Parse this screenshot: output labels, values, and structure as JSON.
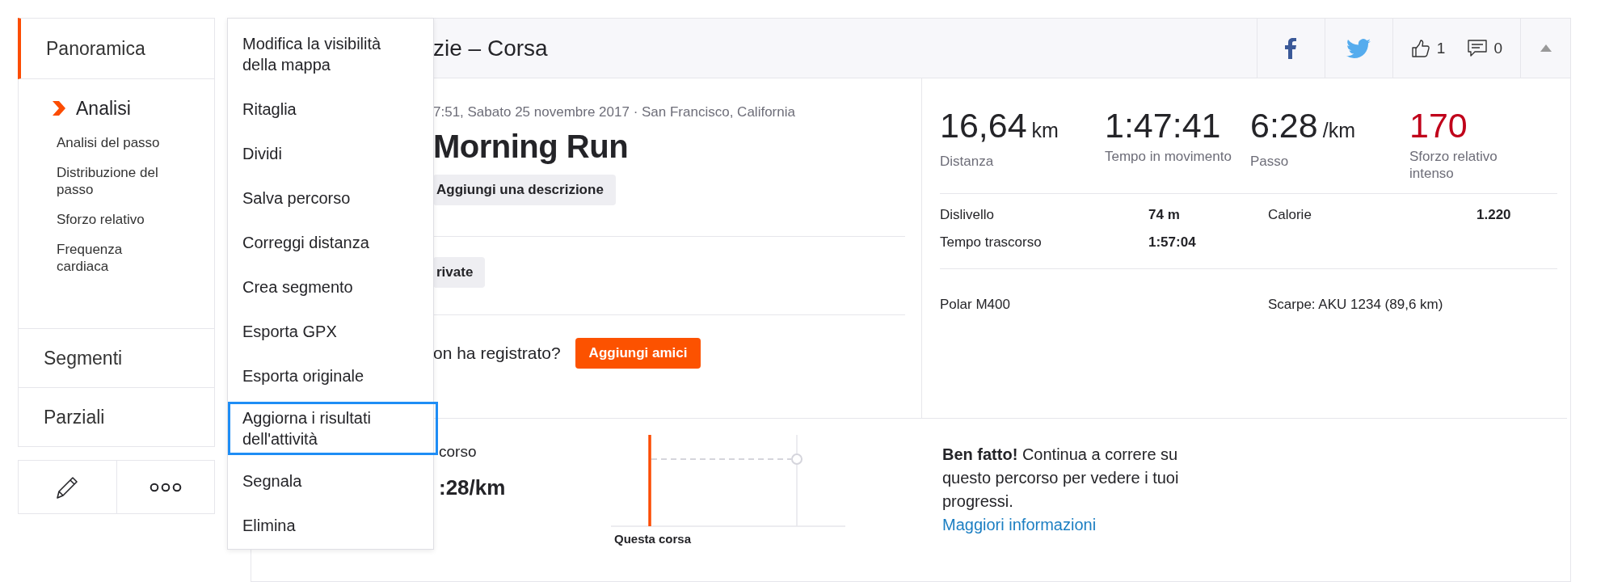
{
  "sidebar": {
    "items": [
      {
        "label": "Panoramica",
        "selected": true,
        "children": [
          {
            "label": "Analisi",
            "selected": true,
            "children": [
              {
                "label": "Analisi del passo",
                "selected": false
              },
              {
                "label": "Distribuzione del passo",
                "selected": false
              },
              {
                "label": "Sforzo relativo",
                "selected": false
              },
              {
                "label": "Frequenza cardiaca",
                "selected": false
              }
            ]
          }
        ]
      },
      {
        "label": "Segmenti",
        "selected": false
      },
      {
        "label": "Parziali",
        "selected": false
      }
    ]
  },
  "actions_menu": {
    "items": [
      {
        "label": "Modifica la visibilità della mappa",
        "selected": false
      },
      {
        "label": "Ritaglia",
        "selected": false
      },
      {
        "label": "Dividi",
        "selected": false
      },
      {
        "label": "Salva percorso",
        "selected": false
      },
      {
        "label": "Correggi distanza",
        "selected": false
      },
      {
        "label": "Crea segmento",
        "selected": false
      },
      {
        "label": "Esporta GPX",
        "selected": false
      },
      {
        "label": "Esporta originale",
        "selected": false
      },
      {
        "label": "Aggiorna i risultati dell'attività",
        "selected": true
      },
      {
        "label": "Segnala",
        "selected": false
      },
      {
        "label": "Elimina",
        "selected": false
      }
    ]
  },
  "header": {
    "title": "zie – Corsa",
    "kudos": "1",
    "comments": "0"
  },
  "activity": {
    "date_location": "7:51, Sabato 25 novembre 2017 · San Francisco, California",
    "title": "Morning Run",
    "description_button": "Aggiungi una descrizione",
    "privacy_button": "rivate",
    "friends_prompt": "on ha registrato?",
    "friends_button": "Aggiungi amici"
  },
  "stats": [
    {
      "value": "16,64",
      "unit": "km",
      "label": "Distanza",
      "color": "#242428"
    },
    {
      "value": "1:47:41",
      "label": "Tempo in movimento",
      "color": "#242428"
    },
    {
      "value": "6:28",
      "unit": "/km",
      "label": "Passo",
      "color": "#242428"
    },
    {
      "value": "170",
      "label": "Sforzo relativo intenso",
      "color": "#c0001a"
    }
  ],
  "details": [
    {
      "label": "Dislivello",
      "value": "74 m"
    },
    {
      "label": "Calorie",
      "value": "1.220"
    },
    {
      "label": "Tempo trascorso",
      "value": "1:57:04"
    }
  ],
  "gear": [
    "Polar M400",
    "Scarpe: AKU 1234 (89,6 km)"
  ],
  "segment": {
    "label": "corso",
    "pace": ":28/km",
    "chart_label": "Questa corsa",
    "message": "**Ben fatto!** Continua a correre su questo percorso per vedere i tuoi progressi.",
    "link": "Maggiori informazioni"
  }
}
